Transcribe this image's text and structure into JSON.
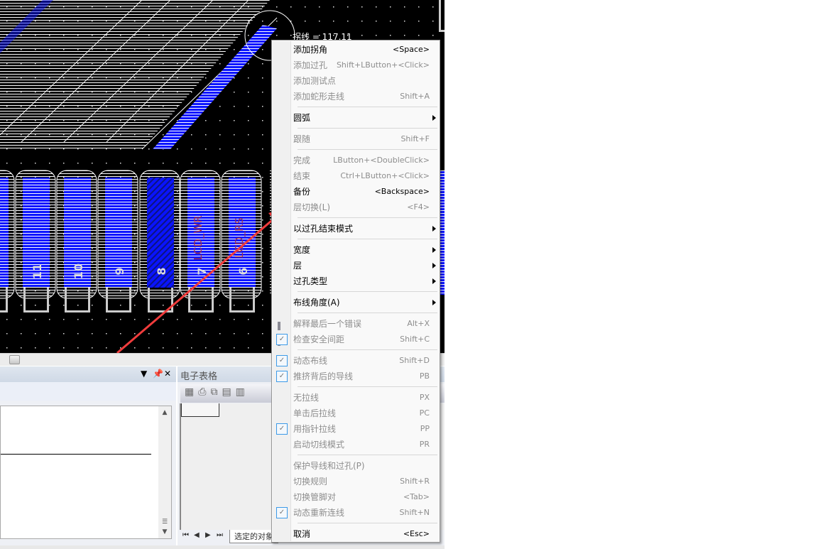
{
  "pcb": {
    "tooltip": "拐线 = 117.11",
    "pad_labels": [
      "11",
      "10",
      "9",
      "8",
      "7",
      "6"
    ],
    "net_labels": [
      "LCD_WR",
      "LCD_RS"
    ],
    "highlighted_pad": "8",
    "colors": {
      "background": "#000000",
      "copper": "#0a14ff",
      "pad_outline": "#ffffff",
      "arrow": "#f03c3c",
      "net_text": "#a0304a"
    }
  },
  "right_panel": {
    "title": "电子表格",
    "tabs": [
      "选定的对象"
    ]
  },
  "context_menu": {
    "items": [
      {
        "label": "添加拐角",
        "shortcut": "<Space>",
        "enabled": true
      },
      {
        "label": "添加过孔",
        "shortcut": "Shift+LButton+<Click>",
        "enabled": false
      },
      {
        "label": "添加测试点",
        "shortcut": "",
        "enabled": false
      },
      {
        "label": "添加蛇形走线",
        "shortcut": "Shift+A",
        "enabled": false,
        "sep": true
      },
      {
        "label": "圆弧",
        "shortcut": "",
        "enabled": true,
        "submenu": true,
        "sep": true
      },
      {
        "label": "跟随",
        "shortcut": "Shift+F",
        "enabled": false,
        "sep": true
      },
      {
        "label": "完成",
        "shortcut": "LButton+<DoubleClick>",
        "enabled": false
      },
      {
        "label": "结束",
        "shortcut": "Ctrl+LButton+<Click>",
        "enabled": false
      },
      {
        "label": "备份",
        "shortcut": "<Backspace>",
        "enabled": true
      },
      {
        "label": "层切换(L)",
        "shortcut": "<F4>",
        "enabled": false,
        "sep": true
      },
      {
        "label": "以过孔结束模式",
        "shortcut": "",
        "enabled": true,
        "submenu": true,
        "sep": true
      },
      {
        "label": "宽度",
        "shortcut": "",
        "enabled": true,
        "submenu": true
      },
      {
        "label": "层",
        "shortcut": "",
        "enabled": true,
        "submenu": true
      },
      {
        "label": "过孔类型",
        "shortcut": "",
        "enabled": true,
        "submenu": true,
        "sep": true
      },
      {
        "label": "布线角度(A)",
        "shortcut": "",
        "enabled": true,
        "submenu": true,
        "sep": true
      },
      {
        "label": "解释最后一个错误",
        "shortcut": "Alt+X",
        "enabled": false,
        "icon": "pause"
      },
      {
        "label": "检查安全间距",
        "shortcut": "Shift+C",
        "enabled": false,
        "checked": true,
        "sep": true
      },
      {
        "label": "动态布线",
        "shortcut": "Shift+D",
        "enabled": false,
        "checked": true
      },
      {
        "label": "推挤背后的导线",
        "shortcut": "PB",
        "enabled": false,
        "checked": true,
        "sep": true
      },
      {
        "label": "无拉线",
        "shortcut": "PX",
        "enabled": false
      },
      {
        "label": "单击后拉线",
        "shortcut": "PC",
        "enabled": false
      },
      {
        "label": "用指针拉线",
        "shortcut": "PP",
        "enabled": false,
        "checked": true
      },
      {
        "label": "启动切线模式",
        "shortcut": "PR",
        "enabled": false,
        "sep": true
      },
      {
        "label": "保护导线和过孔(P)",
        "shortcut": "",
        "enabled": false
      },
      {
        "label": "切换规则",
        "shortcut": "Shift+R",
        "enabled": false
      },
      {
        "label": "切换管脚对",
        "shortcut": "<Tab>",
        "enabled": false
      },
      {
        "label": "动态重新连线",
        "shortcut": "Shift+N",
        "enabled": false,
        "checked": true,
        "sep": true
      },
      {
        "label": "取消",
        "shortcut": "<Esc>",
        "enabled": true
      }
    ]
  }
}
